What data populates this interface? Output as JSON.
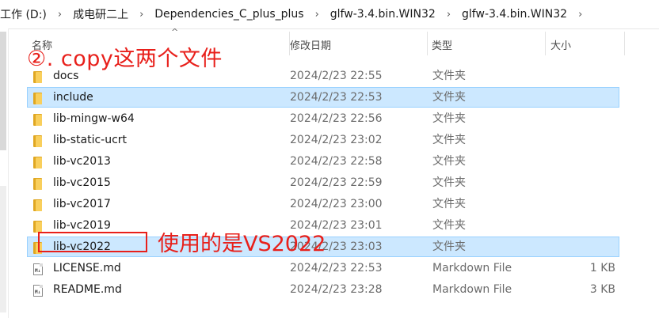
{
  "breadcrumb": [
    "工作 (D:)",
    "成电研二上",
    "Dependencies_C_plus_plus",
    "glfw-3.4.bin.WIN32",
    "glfw-3.4.bin.WIN32"
  ],
  "columns": {
    "name": "名称",
    "modified": "修改日期",
    "type": "类型",
    "size": "大小"
  },
  "files": [
    {
      "name": "docs",
      "modified": "2024/2/23 22:55",
      "type": "文件夹",
      "size": "",
      "icon": "folder-icon",
      "selected": false
    },
    {
      "name": "include",
      "modified": "2024/2/23 22:53",
      "type": "文件夹",
      "size": "",
      "icon": "folder-icon",
      "selected": true
    },
    {
      "name": "lib-mingw-w64",
      "modified": "2024/2/23 22:56",
      "type": "文件夹",
      "size": "",
      "icon": "folder-icon",
      "selected": false
    },
    {
      "name": "lib-static-ucrt",
      "modified": "2024/2/23 23:02",
      "type": "文件夹",
      "size": "",
      "icon": "folder-icon",
      "selected": false
    },
    {
      "name": "lib-vc2013",
      "modified": "2024/2/23 22:58",
      "type": "文件夹",
      "size": "",
      "icon": "folder-icon",
      "selected": false
    },
    {
      "name": "lib-vc2015",
      "modified": "2024/2/23 22:59",
      "type": "文件夹",
      "size": "",
      "icon": "folder-icon",
      "selected": false
    },
    {
      "name": "lib-vc2017",
      "modified": "2024/2/23 23:00",
      "type": "文件夹",
      "size": "",
      "icon": "folder-icon",
      "selected": false
    },
    {
      "name": "lib-vc2019",
      "modified": "2024/2/23 23:01",
      "type": "文件夹",
      "size": "",
      "icon": "folder-icon",
      "selected": false
    },
    {
      "name": "lib-vc2022",
      "modified": "2024/2/23 23:03",
      "type": "文件夹",
      "size": "",
      "icon": "folder-icon",
      "selected": true
    },
    {
      "name": "LICENSE.md",
      "modified": "2024/2/23 22:53",
      "type": "Markdown File",
      "size": "1 KB",
      "icon": "markdown-file-icon",
      "selected": false
    },
    {
      "name": "README.md",
      "modified": "2024/2/23 23:28",
      "type": "Markdown File",
      "size": "3 KB",
      "icon": "markdown-file-icon",
      "selected": false
    }
  ],
  "annotations": {
    "copy_note": "②. copy这两个文件",
    "vs_note": "使用的是VS2022"
  },
  "colors": {
    "annotation": "#e8201b",
    "selection": "#cce8ff",
    "selection_border": "#99d1ff",
    "folder": "#f9cf5c"
  }
}
